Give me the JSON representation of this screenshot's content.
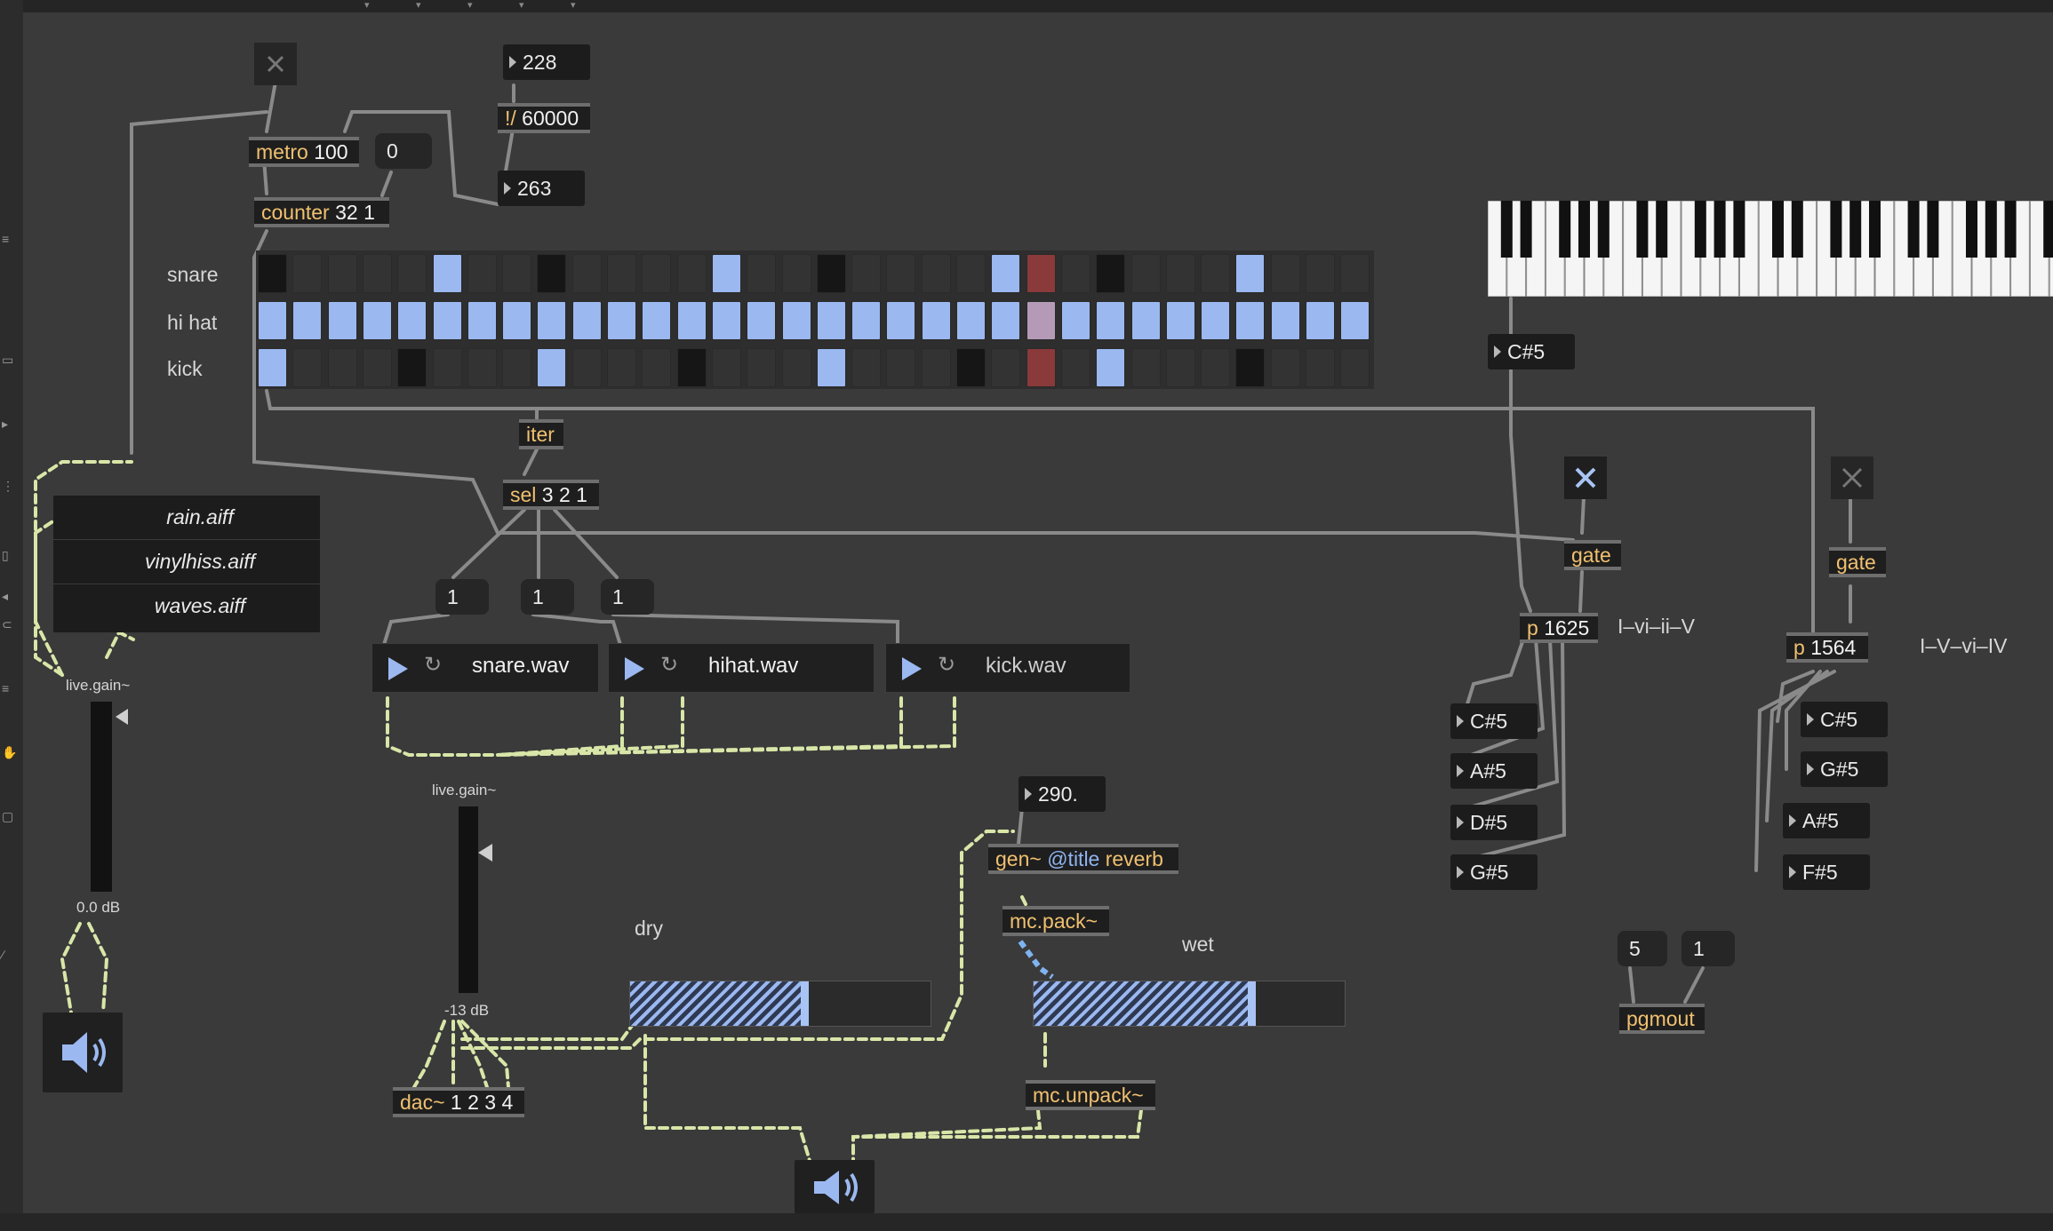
{
  "toolbar": {
    "top_arrows": [
      "▾",
      "▾",
      "▾",
      "▾",
      "▾"
    ]
  },
  "colors": {
    "background": "#3a3a3a",
    "object_text": "#f0c070",
    "active_step": "#9bb8f0",
    "playhead": "#8a3a3a",
    "patch_cord": "#8a8a8a",
    "signal_cord": "#d8e6a8"
  },
  "metro": {
    "name": "metro",
    "args": "100"
  },
  "counter": {
    "name": "counter",
    "args": "32 1"
  },
  "ms_num": "228",
  "divide": {
    "name": "!/",
    "args": "60000"
  },
  "bpm_num": "263",
  "zero_msg": "0",
  "seq": {
    "rows": [
      "snare",
      "hi hat",
      "kick"
    ],
    "steps": 32,
    "playhead_step": 22,
    "snare_active": [
      5,
      13,
      21,
      28
    ],
    "snare_dark": [
      0,
      8,
      16,
      24
    ],
    "hihat_active": [
      0,
      1,
      2,
      3,
      4,
      5,
      6,
      7,
      8,
      9,
      10,
      11,
      12,
      13,
      14,
      15,
      16,
      17,
      18,
      19,
      20,
      21,
      22,
      23,
      24,
      25,
      26,
      27,
      28,
      29,
      30,
      31
    ],
    "kick_active": [
      0,
      8,
      16,
      24
    ],
    "kick_dark": [
      4,
      12,
      20,
      28
    ]
  },
  "iter": {
    "name": "iter"
  },
  "sel": {
    "name": "sel",
    "args": "3 2 1"
  },
  "msgs": [
    "1",
    "1",
    "1"
  ],
  "umenu": {
    "items": [
      "rain.aiff",
      "vinylhiss.aiff",
      "waves.aiff"
    ]
  },
  "live_gain_left": {
    "label": "live.gain~",
    "value": "0.0 dB"
  },
  "live_gain_mid": {
    "label": "live.gain~",
    "value": "-13 dB"
  },
  "players": [
    {
      "file": "snare.wav"
    },
    {
      "file": "hihat.wav"
    },
    {
      "file": "kick.wav"
    }
  ],
  "dac": {
    "name": "dac~",
    "args": "1 2 3 4"
  },
  "reverb_num": "290.",
  "gen": {
    "name": "gen~",
    "attr": "@title",
    "args": "reverb"
  },
  "mc_pack": {
    "name": "mc.pack~"
  },
  "mc_unpack": {
    "name": "mc.unpack~"
  },
  "dry": {
    "label": "dry",
    "level": 0.58
  },
  "wet": {
    "label": "wet",
    "level": 0.7
  },
  "keyboard_note": "C#5",
  "prog1": {
    "name": "p",
    "args": "1625",
    "label": "I–vi–ii–V",
    "notes": [
      "C#5",
      "A#5",
      "D#5",
      "G#5"
    ]
  },
  "prog2": {
    "name": "p",
    "args": "1564",
    "label": "I–V–vi–IV",
    "notes": [
      "C#5",
      "G#5",
      "A#5",
      "F#5"
    ]
  },
  "gate": {
    "name": "gate"
  },
  "pgm": {
    "values": [
      "5",
      "1"
    ],
    "name": "pgmout"
  }
}
